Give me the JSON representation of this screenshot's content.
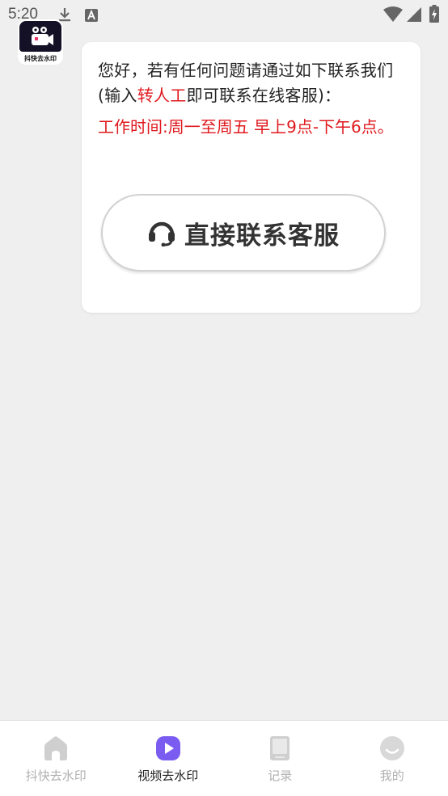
{
  "status_bar": {
    "time": "5:20"
  },
  "app": {
    "logo_text": "抖快去水印",
    "accent_color": "#7b5cf0"
  },
  "message": {
    "line_before_highlight": "您好，若有任何问题请通过如下联系我们(输入",
    "highlight": "转人工",
    "line_after_highlight": "即可联系在线客服)：",
    "work_time": "工作时间:周一至周五 早上9点-下午6点。",
    "highlight_color": "#e0191e"
  },
  "contact_button": {
    "label": "直接联系客服",
    "icon": "headset-icon"
  },
  "tabbar": {
    "tabs": [
      {
        "label": "抖快去水印",
        "icon": "home-icon",
        "active": false
      },
      {
        "label": "视频去水印",
        "icon": "play-icon",
        "active": true
      },
      {
        "label": "记录",
        "icon": "book-icon",
        "active": false
      },
      {
        "label": "我的",
        "icon": "smile-icon",
        "active": false
      }
    ]
  }
}
